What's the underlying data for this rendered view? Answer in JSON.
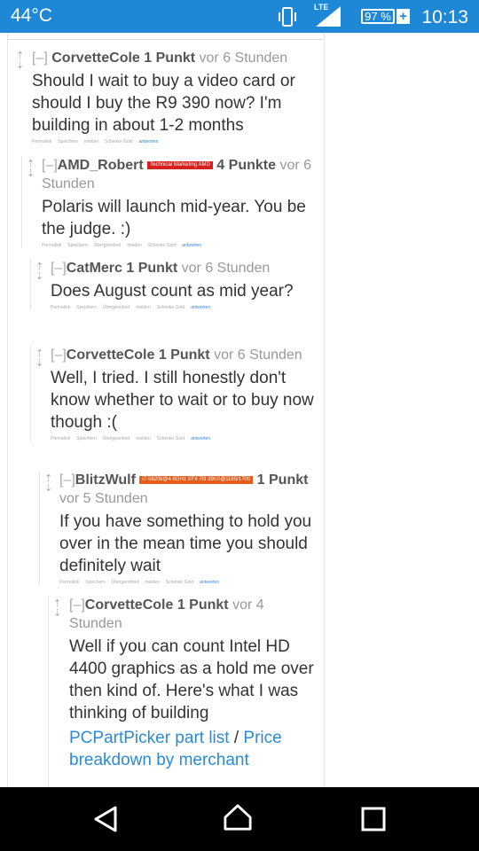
{
  "status_bar": {
    "temperature": "44°C",
    "network": "LTE",
    "battery": "97 %",
    "battery_charging": "+",
    "time": "10:13"
  },
  "buttons": {
    "permalink": "Permalink",
    "save": "Speichern",
    "parent": "Übergeordnet",
    "report": "melden",
    "gold": "Schenke Gold",
    "reply": "antworten"
  },
  "comments": [
    {
      "collapse": "[–]",
      "author": "CorvetteCole",
      "score": "1 Punkt",
      "time": "vor 6 Stunden",
      "body": "Should I wait to buy a video card or should I buy the R9 390 now? I'm building in about 1-2 months"
    },
    {
      "collapse": "[–]",
      "author": "AMD_Robert",
      "flair": "Technical Marketing AMD",
      "score": "4 Punkte",
      "time": "vor 6 Stunden",
      "body": "Polaris will launch mid-year. You be the judge. :)"
    },
    {
      "collapse": "[–]",
      "author": "CatMerc",
      "score": "1 Punkt",
      "time": "vor 6 Stunden",
      "body": "Does August count as mid year?"
    },
    {
      "collapse": "[–]",
      "author": "CorvetteCole",
      "score": "1 Punkt",
      "time": "vor 6 Stunden",
      "body": "Well, I tried. I still honestly don't know whether to wait or to buy now though :("
    },
    {
      "collapse": "[–]",
      "author": "BlitzWulf",
      "flair": "i7-5820k@4.6GHz XFX R9 390X@1165/1700",
      "score": "1 Punkt",
      "time": "vor 5 Stunden",
      "body": "If you have something to hold you over in the mean time you should definitely wait"
    },
    {
      "collapse": "[–]",
      "author": "CorvetteCole",
      "score": "1 Punkt",
      "time": "vor 4 Stunden",
      "body": "Well if you can count Intel HD 4400 graphics as a hold me over then kind of. Here's what I was thinking of building",
      "link1": "PCPartPicker part list",
      "separator": " / ",
      "link2": "Price breakdown by merchant"
    }
  ],
  "colors": {
    "status_bar": "#1e88d6",
    "link": "#2b8ad8",
    "flair_amd": "#d7211e",
    "flair_user": "#e65b1a"
  }
}
